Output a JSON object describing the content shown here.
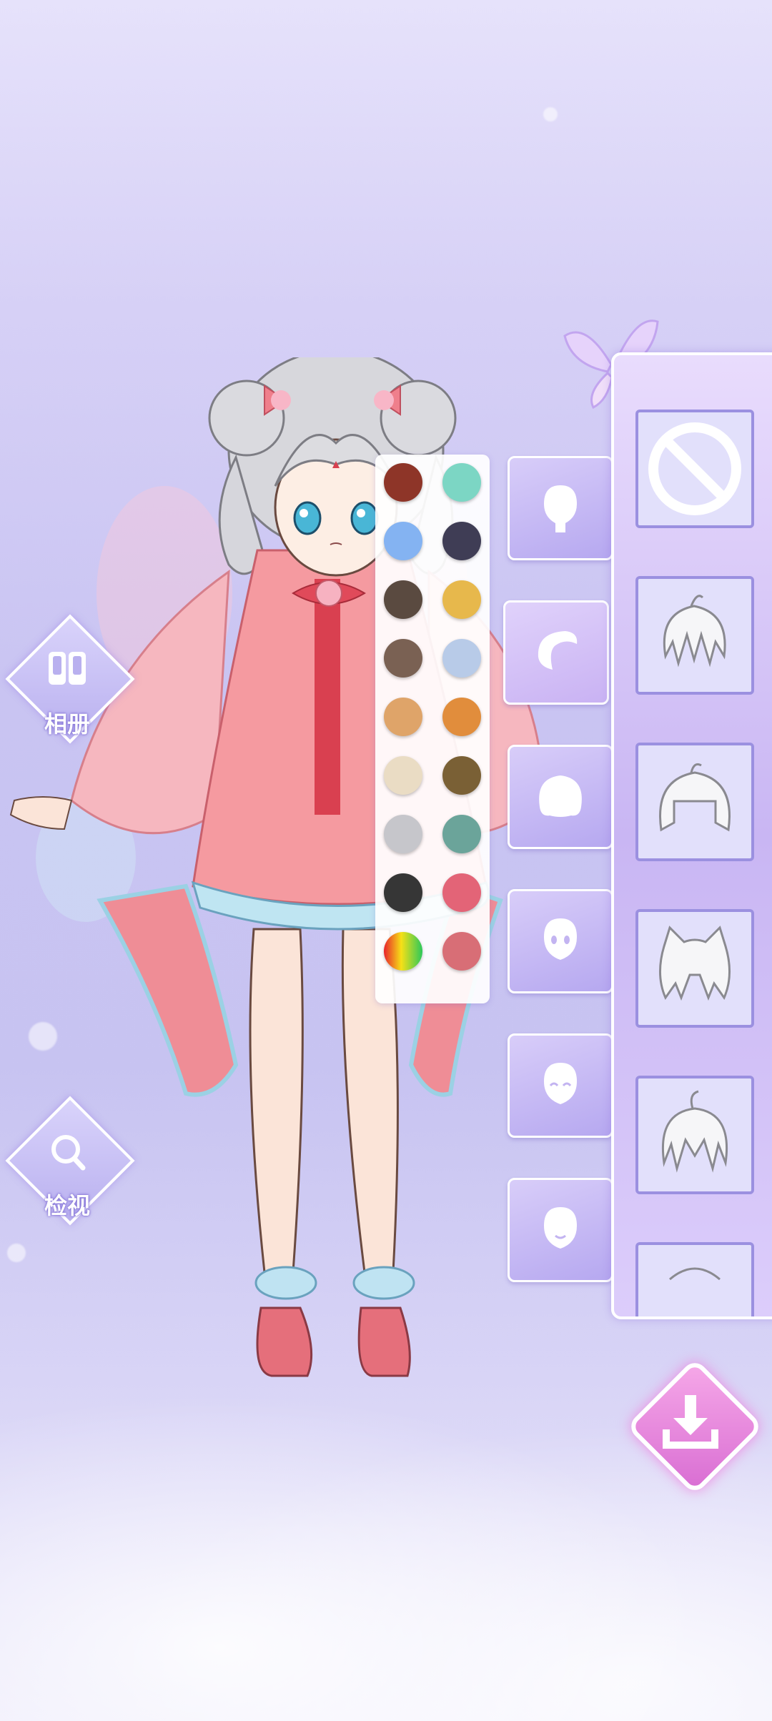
{
  "nav": {
    "album_label": "相册",
    "album_icon": "album-icon",
    "inspect_label": "检视",
    "inspect_icon": "magnifier-icon"
  },
  "palette": {
    "colors": [
      "#8e3528",
      "#7cd6c4",
      "#84b3f2",
      "#3f3d55",
      "#5a4a40",
      "#e7b84c",
      "#7a6153",
      "#b8cbe8",
      "#dfa469",
      "#e18d3c",
      "#eadcc4",
      "#7a6035",
      "#c6c6cb",
      "#6ba49a",
      "#363636",
      "#e36477",
      "gradient",
      "#d86e76"
    ]
  },
  "categories": [
    {
      "name": "face-base",
      "icon": "head-icon"
    },
    {
      "name": "front-hair",
      "icon": "bangs-icon"
    },
    {
      "name": "back-hair",
      "icon": "hair-icon"
    },
    {
      "name": "eyes",
      "icon": "eyes-face-icon"
    },
    {
      "name": "expression",
      "icon": "smile-face-icon"
    },
    {
      "name": "mouth",
      "icon": "mouth-face-icon"
    }
  ],
  "items": [
    {
      "name": "none",
      "icon": "none-icon"
    },
    {
      "name": "hair-1",
      "icon": "spiky-hair-icon"
    },
    {
      "name": "hair-2",
      "icon": "bob-hair-icon"
    },
    {
      "name": "hair-3",
      "icon": "cat-ear-hair-icon"
    },
    {
      "name": "hair-4",
      "icon": "messy-hair-icon"
    },
    {
      "name": "hair-5",
      "icon": "hair-partial-icon"
    }
  ],
  "download_icon": "download-icon"
}
